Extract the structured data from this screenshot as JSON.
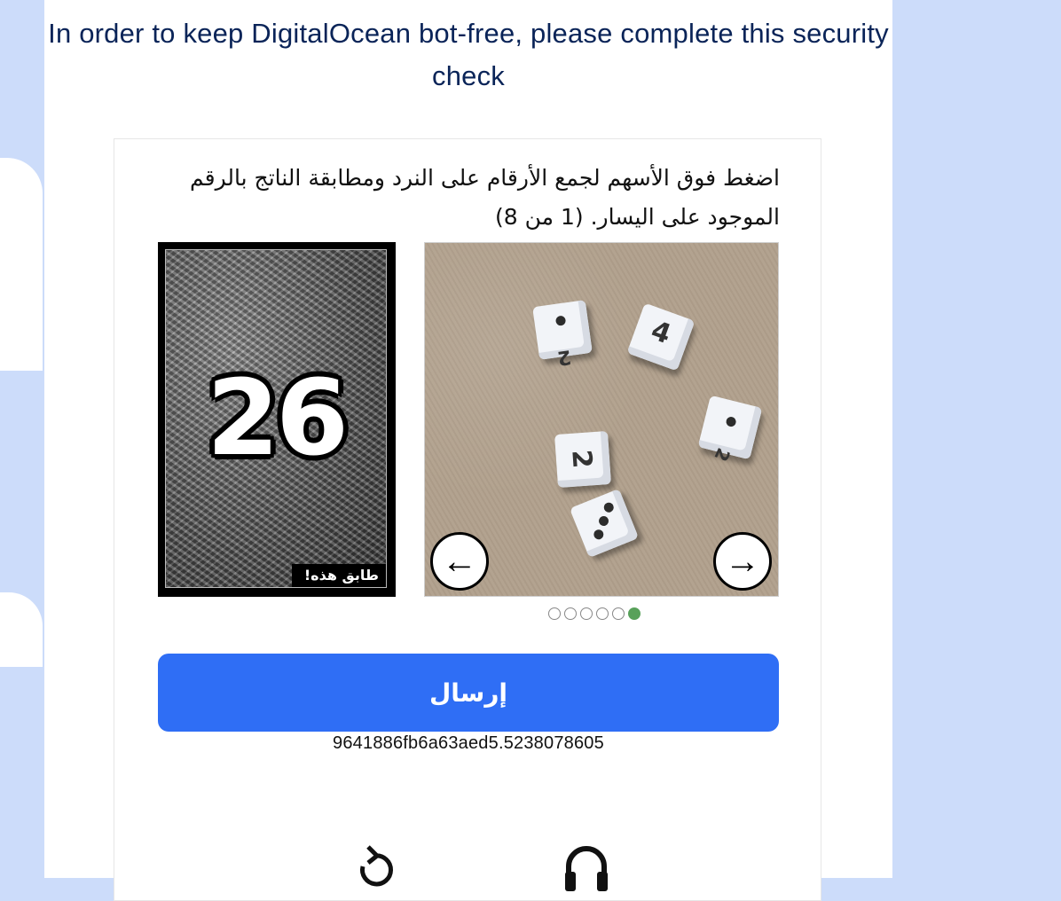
{
  "header": {
    "headline": "In order to keep DigitalOcean bot-free, please complete this security check"
  },
  "captcha": {
    "instruction": "اضغط فوق الأسهم لجمع الأرقام على النرد ومطابقة الناتج بالرقم الموجود على اليسار. (1 من 8)",
    "target_number": "26",
    "match_label": "طابق هذه!",
    "dice_faces": [
      "2",
      "4",
      "2",
      "2",
      "3"
    ],
    "prev_icon": "←",
    "next_icon": "→",
    "pagination": {
      "total": 6,
      "active_index": 5
    },
    "submit_label": "إرسال",
    "session_id": "9641886fb6a63aed5.5238078605",
    "icons": [
      "reload-icon",
      "audio-icon"
    ]
  },
  "colors": {
    "page_background": "#ccdcfa",
    "headline": "#0a2458",
    "submit_button": "#2f6ef5",
    "active_dot": "#58a15a"
  }
}
